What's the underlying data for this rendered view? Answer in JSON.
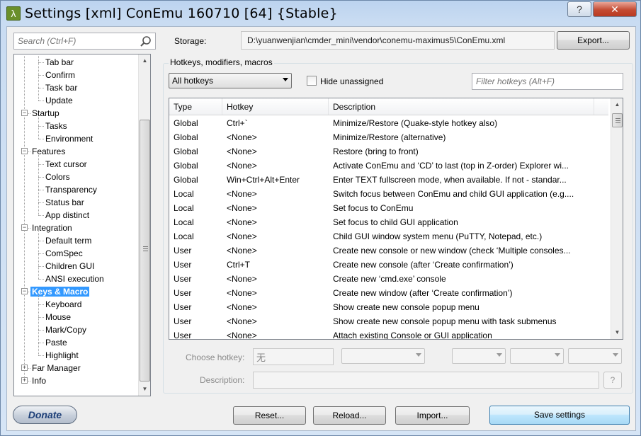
{
  "window": {
    "title": "Settings [xml] ConEmu 160710 [64] {Stable}",
    "help_label": "?",
    "close_label": "✕"
  },
  "sidebar": {
    "search_placeholder": "Search (Ctrl+F)",
    "tree": [
      {
        "label": "Tab bar"
      },
      {
        "label": "Confirm"
      },
      {
        "label": "Task bar"
      },
      {
        "label": "Update"
      },
      {
        "label": "Startup"
      },
      {
        "label": "Tasks"
      },
      {
        "label": "Environment"
      },
      {
        "label": "Features"
      },
      {
        "label": "Text cursor"
      },
      {
        "label": "Colors"
      },
      {
        "label": "Transparency"
      },
      {
        "label": "Status bar"
      },
      {
        "label": "App distinct"
      },
      {
        "label": "Integration"
      },
      {
        "label": "Default term"
      },
      {
        "label": "ComSpec"
      },
      {
        "label": "Children GUI"
      },
      {
        "label": "ANSI execution"
      },
      {
        "label": "Keys & Macro"
      },
      {
        "label": "Keyboard"
      },
      {
        "label": "Mouse"
      },
      {
        "label": "Mark/Copy"
      },
      {
        "label": "Paste"
      },
      {
        "label": "Highlight"
      },
      {
        "label": "Far Manager"
      },
      {
        "label": "Info"
      }
    ]
  },
  "storage": {
    "label": "Storage:",
    "value": "D:\\yuanwenjian\\cmder_mini\\vendor\\conemu-maximus5\\ConEmu.xml",
    "export_label": "Export..."
  },
  "hotkeys": {
    "group_title": "Hotkeys, modifiers, macros",
    "filter_selected": "All hotkeys",
    "hide_unassigned_label": "Hide unassigned",
    "hide_unassigned_checked": false,
    "filter_placeholder": "Filter hotkeys (Alt+F)",
    "columns": [
      "Type",
      "Hotkey",
      "Description"
    ],
    "rows": [
      {
        "type": "Global",
        "hotkey": "Ctrl+`",
        "desc": "Minimize/Restore (Quake-style hotkey also)"
      },
      {
        "type": "Global",
        "hotkey": "<None>",
        "desc": "Minimize/Restore (alternative)"
      },
      {
        "type": "Global",
        "hotkey": "<None>",
        "desc": "Restore (bring to front)"
      },
      {
        "type": "Global",
        "hotkey": "<None>",
        "desc": "Activate ConEmu and ‘CD’ to last (top in Z-order) Explorer wi..."
      },
      {
        "type": "Global",
        "hotkey": "Win+Ctrl+Alt+Enter",
        "desc": "Enter TEXT fullscreen mode, when available. If not - standar..."
      },
      {
        "type": "Local",
        "hotkey": "<None>",
        "desc": "Switch focus between ConEmu and child GUI application (e.g...."
      },
      {
        "type": "Local",
        "hotkey": "<None>",
        "desc": "Set focus to ConEmu"
      },
      {
        "type": "Local",
        "hotkey": "<None>",
        "desc": "Set focus to child GUI application"
      },
      {
        "type": "Local",
        "hotkey": "<None>",
        "desc": "Child GUI window system menu (PuTTY, Notepad, etc.)"
      },
      {
        "type": "User",
        "hotkey": "<None>",
        "desc": "Create new console or new window (check ‘Multiple consoles..."
      },
      {
        "type": "User",
        "hotkey": "Ctrl+T",
        "desc": "Create new console (after ‘Create confirmation’)"
      },
      {
        "type": "User",
        "hotkey": "<None>",
        "desc": "Create new ‘cmd.exe’ console"
      },
      {
        "type": "User",
        "hotkey": "<None>",
        "desc": "Create new window (after ‘Create confirmation’)"
      },
      {
        "type": "User",
        "hotkey": "<None>",
        "desc": "Show create new console popup menu"
      },
      {
        "type": "User",
        "hotkey": "<None>",
        "desc": "Show create new console popup menu with task submenus"
      },
      {
        "type": "User",
        "hotkey": "<None>",
        "desc": "Attach existing Console or GUI application"
      }
    ],
    "choose_hotkey_label": "Choose hotkey:",
    "choose_hotkey_value": "无",
    "description_label": "Description:",
    "description_value": "",
    "description_help": "?"
  },
  "footer": {
    "donate_label": "Donate",
    "reset_label": "Reset...",
    "reload_label": "Reload...",
    "import_label": "Import...",
    "save_label": "Save settings"
  }
}
